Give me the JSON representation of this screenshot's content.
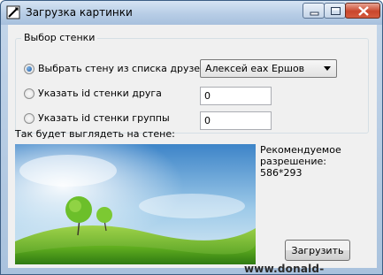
{
  "window": {
    "title": "Загрузка картинки"
  },
  "group": {
    "title": "Выбор стенки",
    "options": [
      {
        "label": "Выбрать стену из списка друзей",
        "checked": true
      },
      {
        "label": "Указать id стенки друга",
        "checked": false
      },
      {
        "label": "Указать id стенки группы",
        "checked": false
      }
    ],
    "friend_select_value": "Алексей еах Ершов",
    "friend_id_value": "0",
    "group_id_value": "0"
  },
  "preview": {
    "label": "Так будет выглядеть на стене:",
    "resolution_text": "Рекомендуемое\nразрешение:\n586*293"
  },
  "actions": {
    "upload_label": "Загрузить"
  },
  "watermark": "www.donald-soft.at.ua",
  "icons": {
    "app": "quill-pen-icon",
    "minimize": "minimize-icon",
    "maximize": "maximize-icon",
    "close": "close-icon",
    "dropdown": "chevron-down-icon"
  }
}
